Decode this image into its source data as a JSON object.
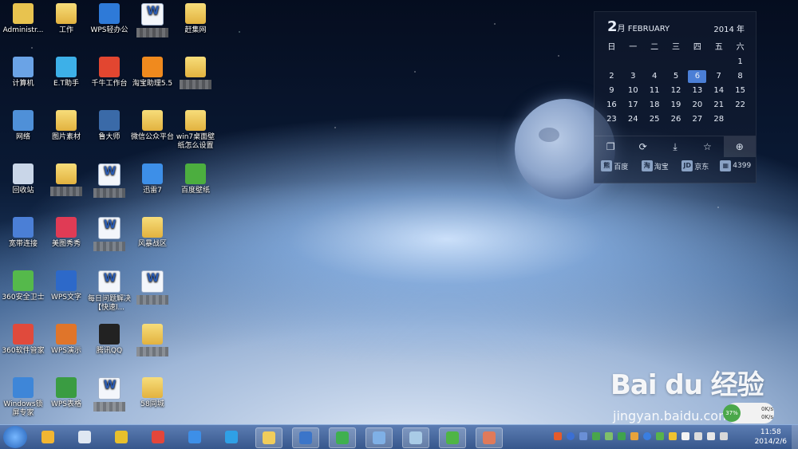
{
  "desktop_icons": [
    {
      "label": "Administr...",
      "icon": "folder-user-icon"
    },
    {
      "label": "计算机",
      "icon": "computer-icon"
    },
    {
      "label": "网络",
      "icon": "network-icon"
    },
    {
      "label": "回收站",
      "icon": "recycle-bin-icon"
    },
    {
      "label": "宽带连接",
      "icon": "broadband-icon"
    },
    {
      "label": "360安全卫士",
      "icon": "360-safe-icon"
    },
    {
      "label": "360软件管家",
      "icon": "360-software-icon"
    },
    {
      "label": "Windows锁屏专家",
      "icon": "lockscreen-icon"
    },
    {
      "label": "工作",
      "icon": "folder-icon"
    },
    {
      "label": "E.T助手",
      "icon": "et-assistant-icon"
    },
    {
      "label": "图片素材",
      "icon": "folder-icon"
    },
    {
      "label": "",
      "icon": "folder-icon"
    },
    {
      "label": "美图秀秀",
      "icon": "meitu-icon"
    },
    {
      "label": "WPS文字",
      "icon": "wps-writer-icon"
    },
    {
      "label": "WPS演示",
      "icon": "wps-presentation-icon"
    },
    {
      "label": "WPS表格",
      "icon": "wps-spreadsheet-icon"
    },
    {
      "label": "WPS轻办公",
      "icon": "wps-light-icon"
    },
    {
      "label": "千牛工作台",
      "icon": "qianniu-icon"
    },
    {
      "label": "鲁大师",
      "icon": "ludashi-icon"
    },
    {
      "label": "",
      "icon": "document-icon"
    },
    {
      "label": "",
      "icon": "document-icon"
    },
    {
      "label": "每日问题解决【快速l...",
      "icon": "document-icon"
    },
    {
      "label": "腾讯QQ",
      "icon": "qq-icon"
    },
    {
      "label": "",
      "icon": "document-icon"
    },
    {
      "label": "",
      "icon": "document-icon"
    },
    {
      "label": "淘宝助理5.5",
      "icon": "taobao-assistant-icon"
    },
    {
      "label": "微信公众平台",
      "icon": "folder-icon"
    },
    {
      "label": "迅雷7",
      "icon": "xunlei-icon"
    },
    {
      "label": "风暴战区",
      "icon": "folder-icon"
    },
    {
      "label": "",
      "icon": "document-icon"
    },
    {
      "label": "",
      "icon": "folder-icon"
    },
    {
      "label": "58同城",
      "icon": "folder-icon"
    },
    {
      "label": "赶集网",
      "icon": "folder-icon"
    },
    {
      "label": "",
      "icon": "folder-icon"
    },
    {
      "label": "win7桌面壁纸怎么设置",
      "icon": "folder-icon"
    },
    {
      "label": "百度壁纸",
      "icon": "baidu-wallpaper-icon"
    }
  ],
  "calendar": {
    "month_num": "2",
    "month_suffix": "月 FEBRUARY",
    "year": "2014 年",
    "weekdays": [
      "日",
      "一",
      "二",
      "三",
      "四",
      "五",
      "六"
    ],
    "weeks": [
      [
        "",
        "",
        "",
        "",
        "",
        "",
        "1"
      ],
      [
        "2",
        "3",
        "4",
        "5",
        "6",
        "7",
        "8"
      ],
      [
        "9",
        "10",
        "11",
        "12",
        "13",
        "14",
        "15"
      ],
      [
        "16",
        "17",
        "18",
        "19",
        "20",
        "21",
        "22"
      ],
      [
        "23",
        "24",
        "25",
        "26",
        "27",
        "28",
        ""
      ]
    ],
    "today": "6",
    "tools": [
      {
        "icon": "window-icon"
      },
      {
        "icon": "refresh-icon"
      },
      {
        "icon": "download-icon"
      },
      {
        "icon": "star-icon"
      },
      {
        "icon": "globe-icon"
      }
    ],
    "links": [
      {
        "label": "百度",
        "icon": "baidu-icon"
      },
      {
        "label": "淘宝",
        "icon": "taobao-icon"
      },
      {
        "label": "京东",
        "icon": "jd-icon"
      },
      {
        "label": "4399",
        "icon": "4399-icon"
      }
    ]
  },
  "watermark": {
    "main": "Bai du 经验",
    "sub": "jingyan.baidu.com"
  },
  "net_widget": {
    "percent": "37%",
    "up": "0K/s",
    "down": "0K/s"
  },
  "taskbar": {
    "apps": [
      {
        "icon": "windows-logo-icon"
      },
      {
        "icon": "home-icon"
      },
      {
        "icon": "chrome-icon"
      },
      {
        "icon": "weibo-icon"
      },
      {
        "icon": "xunlei-icon"
      },
      {
        "icon": "qq-browser-icon"
      },
      {
        "icon": "explorer-folder-icon"
      },
      {
        "icon": "media-player-icon"
      },
      {
        "icon": "ie-icon"
      },
      {
        "icon": "remote-desktop-icon"
      },
      {
        "icon": "notepad-icon"
      },
      {
        "icon": "wallpaper-icon"
      },
      {
        "icon": "contacts-icon"
      }
    ],
    "clock_time": "11:58",
    "clock_date": "2014/2/6"
  },
  "colors": {
    "accent": "#4b7fd6",
    "taskbar": "#37578c"
  }
}
